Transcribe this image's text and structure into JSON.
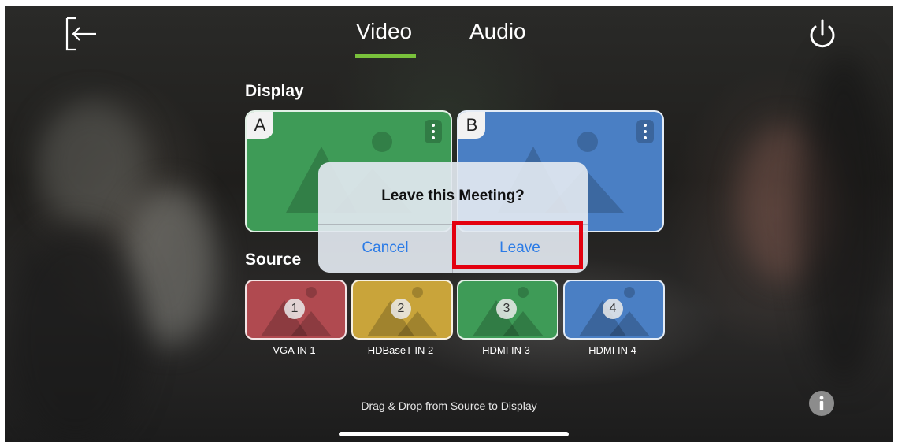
{
  "tabs": [
    {
      "label": "Video",
      "active": true
    },
    {
      "label": "Audio",
      "active": false
    }
  ],
  "icons": {
    "back": "back-arrow-icon",
    "power": "power-icon",
    "menu": "kebab-menu-icon",
    "info": "info-icon",
    "placeholder": "image-placeholder-icon"
  },
  "display": {
    "title": "Display",
    "cards": [
      {
        "letter": "A",
        "color": "#3e9b57"
      },
      {
        "letter": "B",
        "color": "#4a7fc4"
      }
    ]
  },
  "source": {
    "title": "Source",
    "items": [
      {
        "number": "1",
        "label": "VGA IN 1",
        "color": "#b04a50"
      },
      {
        "number": "2",
        "label": "HDBaseT IN 2",
        "color": "#c9a43a"
      },
      {
        "number": "3",
        "label": "HDMI IN 3",
        "color": "#3e9b57"
      },
      {
        "number": "4",
        "label": "HDMI IN 4",
        "color": "#4a7fc4"
      }
    ]
  },
  "hint": "Drag & Drop from Source to Display",
  "dialog": {
    "title": "Leave this Meeting?",
    "cancel_label": "Cancel",
    "leave_label": "Leave"
  },
  "colors": {
    "accent_underline": "#79c13b",
    "dialog_button": "#2b7be6",
    "highlight": "#e3000f"
  }
}
